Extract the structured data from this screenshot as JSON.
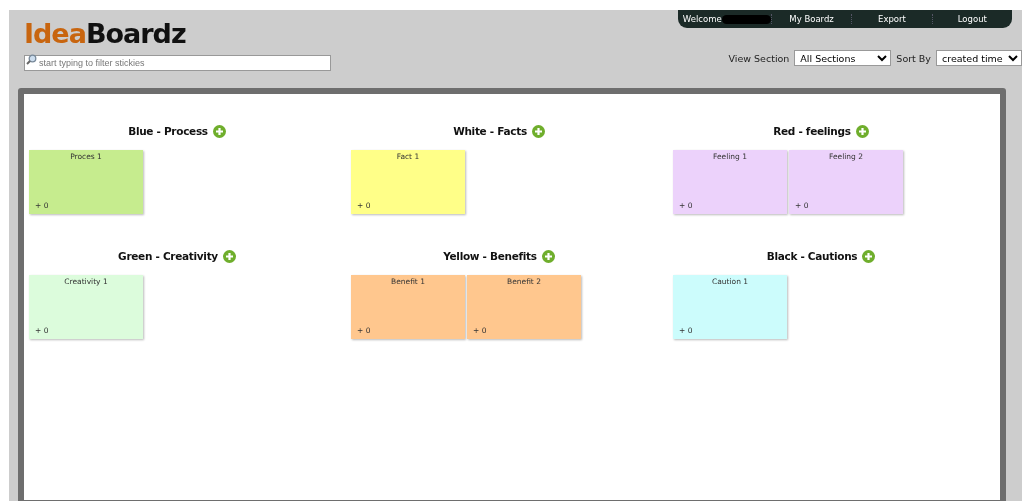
{
  "logo": {
    "part_1": "Idea",
    "part_2": "Boardz"
  },
  "filter": {
    "placeholder": "start typing to filter stickies"
  },
  "nav": {
    "welcome": "Welcome",
    "items": [
      "My Boardz",
      "Export",
      "Logout"
    ]
  },
  "view_section": {
    "label": "View Section",
    "value": "All Sections"
  },
  "sort_by": {
    "label": "Sort By",
    "value": "created time"
  },
  "sections": [
    {
      "title": "Blue - Process",
      "stickies": [
        {
          "text": "Proces 1",
          "votes": "+ 0",
          "color": "#c6ec8e"
        }
      ]
    },
    {
      "title": "White - Facts",
      "stickies": [
        {
          "text": "Fact 1",
          "votes": "+ 0",
          "color": "#ffff88"
        }
      ]
    },
    {
      "title": "Red - feelings",
      "stickies": [
        {
          "text": "Feeling 1",
          "votes": "+ 0",
          "color": "#ecd2fb"
        },
        {
          "text": "Feeling 2",
          "votes": "+ 0",
          "color": "#ecd2fb"
        }
      ]
    },
    {
      "title": "Green - Creativity",
      "stickies": [
        {
          "text": "Creativity 1",
          "votes": "+ 0",
          "color": "#dcfcdc"
        }
      ]
    },
    {
      "title": "Yellow - Benefits",
      "stickies": [
        {
          "text": "Benefit 1",
          "votes": "+ 0",
          "color": "#ffc78e"
        },
        {
          "text": "Benefit 2",
          "votes": "+ 0",
          "color": "#ffc78e"
        }
      ]
    },
    {
      "title": "Black - Cautions",
      "stickies": [
        {
          "text": "Caution 1",
          "votes": "+ 0",
          "color": "#ccfcfc"
        }
      ]
    }
  ]
}
